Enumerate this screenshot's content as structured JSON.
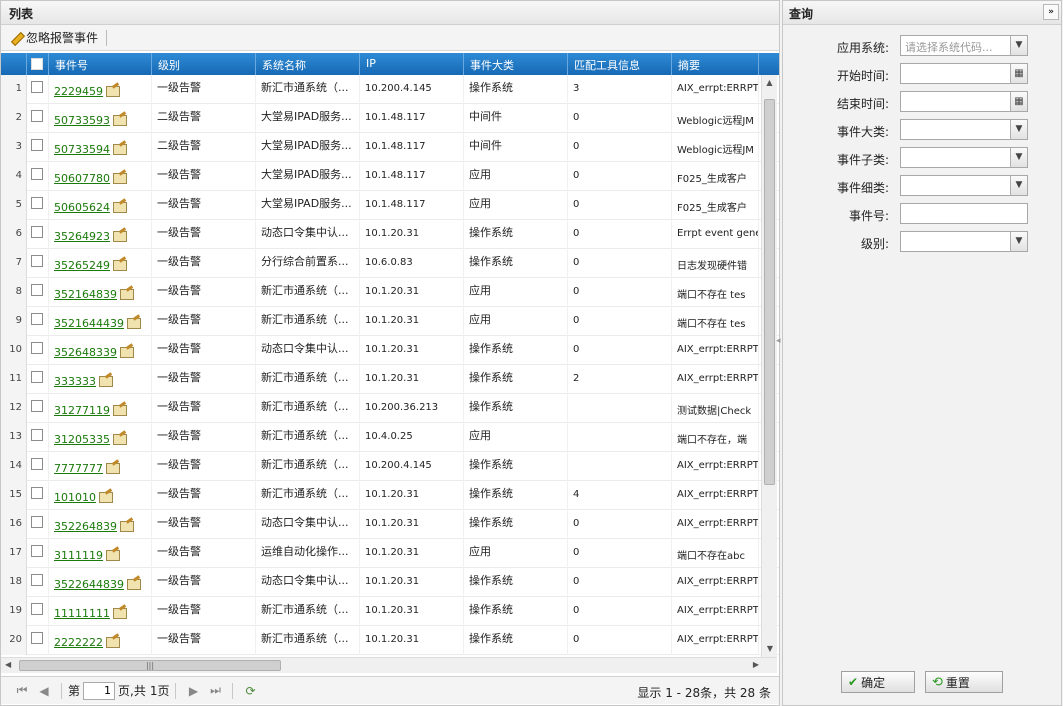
{
  "list": {
    "title": "列表",
    "ignore_button": "忽略报警事件",
    "columns": [
      "事件号",
      "级别",
      "系统名称",
      "IP",
      "事件大类",
      "匹配工具信息",
      "摘要"
    ],
    "rows": [
      {
        "n": "1",
        "id": "2229459",
        "level": "一级告警",
        "system": "新汇市通系统（...",
        "ip": "10.200.4.145",
        "category": "操作系统",
        "count": "3",
        "summary": "AIX_errpt:ERRPT"
      },
      {
        "n": "2",
        "id": "50733593",
        "level": "二级告警",
        "system": "大堂易IPAD服务...",
        "ip": "10.1.48.117",
        "category": "中间件",
        "count": "0",
        "summary": "Weblogic远程JM"
      },
      {
        "n": "3",
        "id": "50733594",
        "level": "二级告警",
        "system": "大堂易IPAD服务...",
        "ip": "10.1.48.117",
        "category": "中间件",
        "count": "0",
        "summary": "Weblogic远程JM"
      },
      {
        "n": "4",
        "id": "50607780",
        "level": "一级告警",
        "system": "大堂易IPAD服务...",
        "ip": "10.1.48.117",
        "category": "应用",
        "count": "0",
        "summary": "F025_生成客户"
      },
      {
        "n": "5",
        "id": "50605624",
        "level": "一级告警",
        "system": "大堂易IPAD服务...",
        "ip": "10.1.48.117",
        "category": "应用",
        "count": "0",
        "summary": "F025_生成客户"
      },
      {
        "n": "6",
        "id": "35264923",
        "level": "一级告警",
        "system": "动态口令集中认...",
        "ip": "10.1.20.31",
        "category": "操作系统",
        "count": "0",
        "summary": "Errpt event gene"
      },
      {
        "n": "7",
        "id": "35265249",
        "level": "一级告警",
        "system": "分行综合前置系...",
        "ip": "10.6.0.83",
        "category": "操作系统",
        "count": "0",
        "summary": "日志发现硬件错"
      },
      {
        "n": "8",
        "id": "352164839",
        "level": "一级告警",
        "system": "新汇市通系统（...",
        "ip": "10.1.20.31",
        "category": "应用",
        "count": "0",
        "summary": "端口不存在  tes"
      },
      {
        "n": "9",
        "id": "3521644439",
        "level": "一级告警",
        "system": "新汇市通系统（...",
        "ip": "10.1.20.31",
        "category": "应用",
        "count": "0",
        "summary": "端口不存在  tes"
      },
      {
        "n": "10",
        "id": "352648339",
        "level": "一级告警",
        "system": "动态口令集中认...",
        "ip": "10.1.20.31",
        "category": "操作系统",
        "count": "0",
        "summary": "AIX_errpt:ERRPT"
      },
      {
        "n": "11",
        "id": "333333",
        "level": "一级告警",
        "system": "新汇市通系统（...",
        "ip": "10.1.20.31",
        "category": "操作系统",
        "count": "2",
        "summary": "AIX_errpt:ERRPT"
      },
      {
        "n": "12",
        "id": "31277119",
        "level": "一级告警",
        "system": "新汇市通系统（...",
        "ip": "10.200.36.213",
        "category": "操作系统",
        "count": "",
        "summary": "测试数据|Check"
      },
      {
        "n": "13",
        "id": "31205335",
        "level": "一级告警",
        "system": "新汇市通系统（...",
        "ip": "10.4.0.25",
        "category": "应用",
        "count": "",
        "summary": "端口不存在，端"
      },
      {
        "n": "14",
        "id": "7777777",
        "level": "一级告警",
        "system": "新汇市通系统（...",
        "ip": "10.200.4.145",
        "category": "操作系统",
        "count": "",
        "summary": "AIX_errpt:ERRPT"
      },
      {
        "n": "15",
        "id": "101010",
        "level": "一级告警",
        "system": "新汇市通系统（...",
        "ip": "10.1.20.31",
        "category": "操作系统",
        "count": "4",
        "summary": "AIX_errpt:ERRPT"
      },
      {
        "n": "16",
        "id": "352264839",
        "level": "一级告警",
        "system": "动态口令集中认...",
        "ip": "10.1.20.31",
        "category": "操作系统",
        "count": "0",
        "summary": "AIX_errpt:ERRPT"
      },
      {
        "n": "17",
        "id": "3111119",
        "level": "一级告警",
        "system": "运维自动化操作...",
        "ip": "10.1.20.31",
        "category": "应用",
        "count": "0",
        "summary": "端口不存在abc"
      },
      {
        "n": "18",
        "id": "3522644839",
        "level": "一级告警",
        "system": "动态口令集中认...",
        "ip": "10.1.20.31",
        "category": "操作系统",
        "count": "0",
        "summary": "AIX_errpt:ERRPT"
      },
      {
        "n": "19",
        "id": "11111111",
        "level": "一级告警",
        "system": "新汇市通系统（...",
        "ip": "10.1.20.31",
        "category": "操作系统",
        "count": "0",
        "summary": "AIX_errpt:ERRPT"
      },
      {
        "n": "20",
        "id": "2222222",
        "level": "一级告警",
        "system": "新汇市通系统（...",
        "ip": "10.1.20.31",
        "category": "操作系统",
        "count": "0",
        "summary": "AIX_errpt:ERRPT"
      }
    ]
  },
  "pager": {
    "page_prefix": "第",
    "page_value": "1",
    "page_suffix": "页,共",
    "total_pages": "1页",
    "status": "显示 1 - 28条，共 28 条"
  },
  "query": {
    "title": "查询",
    "fields": [
      {
        "label": "应用系统:",
        "placeholder": "请选择系统代码...",
        "type": "select"
      },
      {
        "label": "开始时间:",
        "placeholder": "",
        "type": "date"
      },
      {
        "label": "结束时间:",
        "placeholder": "",
        "type": "date"
      },
      {
        "label": "事件大类:",
        "placeholder": "",
        "type": "select"
      },
      {
        "label": "事件子类:",
        "placeholder": "",
        "type": "select"
      },
      {
        "label": "事件细类:",
        "placeholder": "",
        "type": "select"
      },
      {
        "label": "事件号:",
        "placeholder": "",
        "type": "text"
      },
      {
        "label": "级别:",
        "placeholder": "",
        "type": "select"
      }
    ],
    "confirm_label": "确定",
    "reset_label": "重置"
  },
  "colors": {
    "header_blue": "#1769b4",
    "link_green": "#1a7a0a"
  }
}
